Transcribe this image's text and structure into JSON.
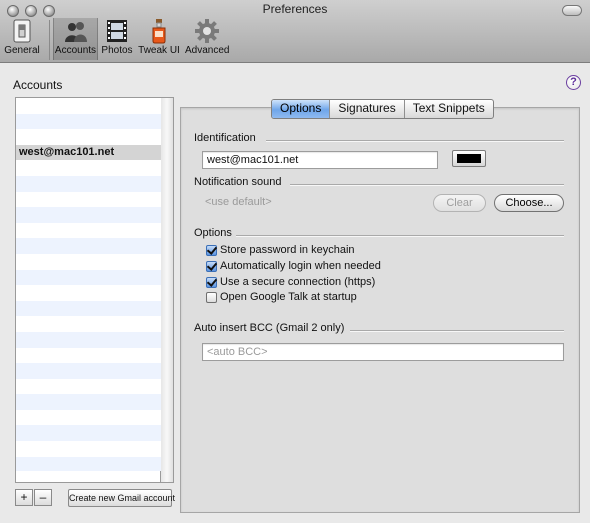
{
  "window": {
    "title": "Preferences"
  },
  "toolbar": {
    "items": [
      {
        "label": "General",
        "icon": "light-switch-icon"
      },
      {
        "label": "Accounts",
        "icon": "people-icon",
        "selected": true
      },
      {
        "label": "Photos",
        "icon": "film-icon"
      },
      {
        "label": "Tweak UI",
        "icon": "potion-bottle-icon"
      },
      {
        "label": "Advanced",
        "icon": "gear-icon"
      }
    ]
  },
  "accounts": {
    "label": "Accounts",
    "rows": [
      "",
      "",
      "",
      "west@mac101.net",
      "",
      "",
      "",
      "",
      "",
      "",
      "",
      "",
      "",
      "",
      "",
      "",
      "",
      "",
      "",
      "",
      "",
      "",
      "",
      ""
    ],
    "selected_index": 3,
    "add_label": "+",
    "remove_label": "–",
    "create_label": "Create new Gmail account"
  },
  "help": {
    "label": "?"
  },
  "tabs": [
    {
      "label": "Options",
      "active": true
    },
    {
      "label": "Signatures"
    },
    {
      "label": "Text Snippets"
    }
  ],
  "identification": {
    "heading": "Identification",
    "value": "west@mac101.net",
    "color": "#000000"
  },
  "notification": {
    "heading": "Notification sound",
    "placeholder": "<use default>",
    "clear_label": "Clear",
    "choose_label": "Choose..."
  },
  "options": {
    "heading": "Options",
    "items": [
      {
        "label": "Store password in keychain",
        "checked": true
      },
      {
        "label": "Automatically login when needed",
        "checked": true
      },
      {
        "label": "Use a secure connection (https)",
        "checked": true
      },
      {
        "label": "Open Google Talk at startup",
        "checked": false
      }
    ]
  },
  "bcc": {
    "heading": "Auto insert BCC (Gmail 2 only)",
    "placeholder": "<auto BCC>"
  }
}
